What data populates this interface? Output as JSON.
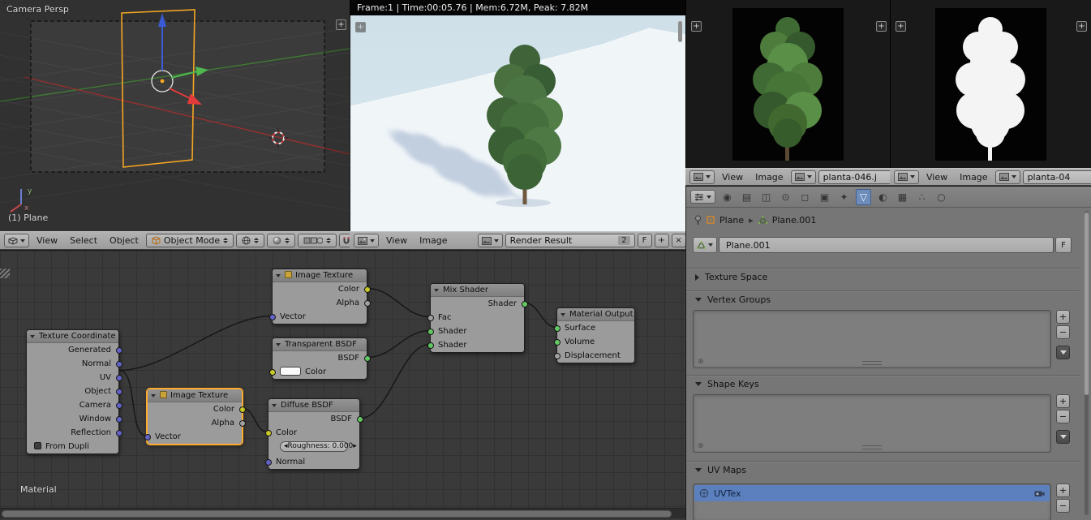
{
  "theme": {
    "selection_blue": "#5b80bd",
    "node_selected_outline": "#ffab2e",
    "plane_outline_orange": "#f5a623",
    "axis_red": "#e33b3b",
    "axis_green": "#4fb84f",
    "axis_blue": "#3b5bd6",
    "socket_vector": "#6363c7",
    "socket_color": "#c7c729",
    "socket_shader": "#63c763",
    "socket_value": "#a1a1a1"
  },
  "icons": {
    "plus": "+",
    "minus": "−",
    "close": "×",
    "breadcrumb_arrow": "▸",
    "slider_left": "◂",
    "slider_right": "▸",
    "filter_toggle": "⊕"
  },
  "viewport": {
    "view_label": "Camera Persp",
    "object_info": "(1) Plane",
    "axis_y_label": "y",
    "axis_x_label": "x",
    "header": {
      "menu_view": "View",
      "menu_select": "Select",
      "menu_object": "Object",
      "mode": "Object Mode"
    }
  },
  "render_view": {
    "stats": "Frame:1 | Time:00:05.76 | Mem:6.72M, Peak: 7.82M",
    "header": {
      "menu_view": "View",
      "menu_image": "Image",
      "datablock": "Render Result",
      "users": "2",
      "fake_user": "F"
    }
  },
  "image_editor_1": {
    "header": {
      "menu_view": "View",
      "menu_image": "Image",
      "image_name": "planta-046.j"
    }
  },
  "image_editor_2": {
    "header": {
      "menu_view": "View",
      "menu_image": "Image",
      "image_name": "planta-04"
    }
  },
  "properties": {
    "tabs": [
      {
        "name": "render",
        "glyph": "◉"
      },
      {
        "name": "render-layers",
        "glyph": "▤"
      },
      {
        "name": "scene",
        "glyph": "◫"
      },
      {
        "name": "world",
        "glyph": "⊙"
      },
      {
        "name": "object",
        "glyph": "◻"
      },
      {
        "name": "constraints",
        "glyph": "▣"
      },
      {
        "name": "modifiers",
        "glyph": "✦"
      },
      {
        "name": "data",
        "glyph": "▽"
      },
      {
        "name": "material",
        "glyph": "◐"
      },
      {
        "name": "texture",
        "glyph": "▦"
      },
      {
        "name": "particles",
        "glyph": "∴"
      },
      {
        "name": "physics",
        "glyph": "○"
      }
    ],
    "breadcrumb": {
      "object": "Plane",
      "data": "Plane.001"
    },
    "name_field": {
      "value": "Plane.001",
      "fake_user": "F"
    },
    "panels": {
      "texture_space": "Texture Space",
      "vertex_groups": "Vertex Groups",
      "shape_keys": "Shape Keys",
      "uv_maps": "UV Maps"
    },
    "uv_maps": {
      "selected": "UVTex"
    }
  },
  "node_editor": {
    "tree_name": "Material",
    "nodes": {
      "texcoord": {
        "title": "Texture Coordinate",
        "outputs": [
          "Generated",
          "Normal",
          "UV",
          "Object",
          "Camera",
          "Window",
          "Reflection"
        ],
        "option": "From Dupli"
      },
      "imgtex1": {
        "title": "Image Texture",
        "outputs": [
          "Color",
          "Alpha"
        ],
        "inputs": [
          "Vector"
        ]
      },
      "transparent": {
        "title": "Transparent BSDF",
        "outputs": [
          "BSDF"
        ],
        "inputs": [
          "Color"
        ]
      },
      "imgtex2": {
        "title": "Image Texture",
        "outputs": [
          "Color",
          "Alpha"
        ],
        "inputs": [
          "Vector"
        ]
      },
      "diffuse": {
        "title": "Diffuse BSDF",
        "outputs": [
          "BSDF"
        ],
        "inputs": [
          "Color"
        ],
        "slider": "Roughness: 0.000",
        "input_normal": "Normal"
      },
      "mix": {
        "title": "Mix Shader",
        "outputs": [
          "Shader"
        ],
        "inputs": [
          "Fac",
          "Shader",
          "Shader"
        ]
      },
      "material_output": {
        "title": "Material Output",
        "inputs": [
          "Surface",
          "Volume",
          "Displacement"
        ]
      }
    }
  }
}
